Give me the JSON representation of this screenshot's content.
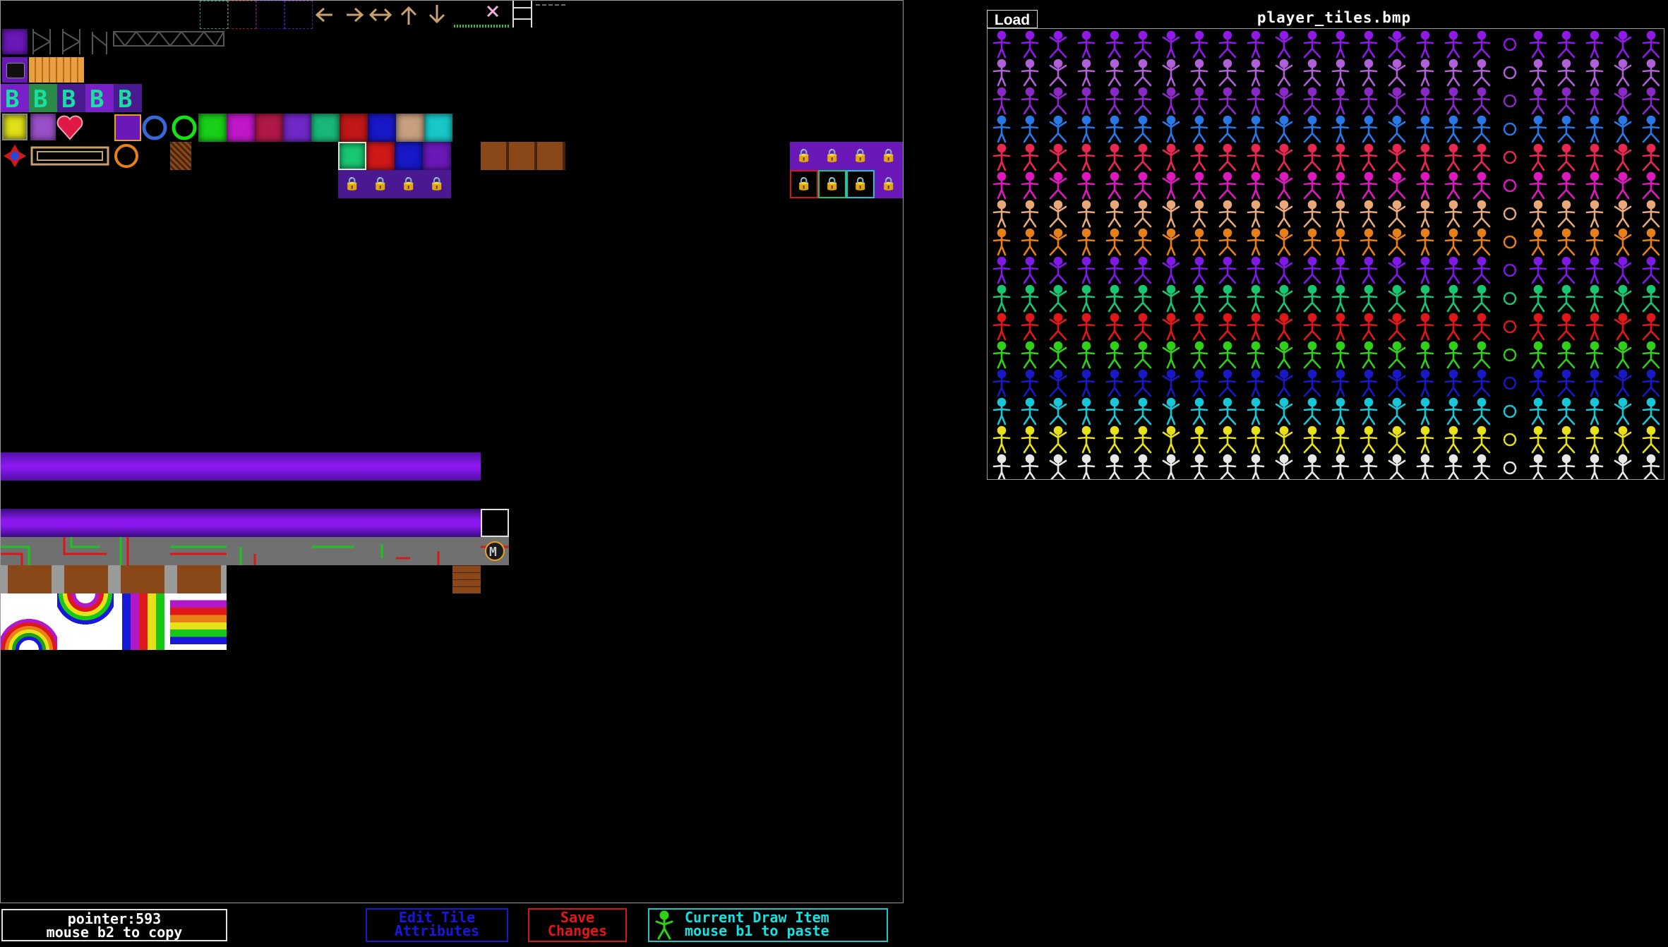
{
  "palette": {
    "load_label": "Load",
    "file_name": "player_tiles.bmp",
    "row_colors": [
      "#9018e8",
      "#b060d8",
      "#8c28c8",
      "#2878e8",
      "#e82850",
      "#e018c0",
      "#e8a878",
      "#e88018",
      "#8018e8",
      "#18c870",
      "#e01818",
      "#30d018",
      "#1818c8",
      "#18c8d8",
      "#e8e018",
      "#e8e8e8"
    ],
    "columns": 24,
    "special_column_index": 18
  },
  "status": {
    "pointer_text": "pointer:593",
    "hint_text": "mouse b2 to copy"
  },
  "buttons": {
    "edit_attributes_line1": "Edit Tile",
    "edit_attributes_line2": "Attributes",
    "save_line1": "Save",
    "save_line2": "Changes",
    "current_line1": "Current Draw Item",
    "current_line2": "mouse b1 to paste"
  },
  "tiles": {
    "bonus_letter": "B",
    "marker_letter": "M"
  },
  "colors": {
    "purple": "#8c18f0",
    "green": "#18c870",
    "red": "#e01818",
    "blue": "#1818d8",
    "cyan": "#18c8d8",
    "orange": "#e88018",
    "tan": "#c8a070"
  }
}
